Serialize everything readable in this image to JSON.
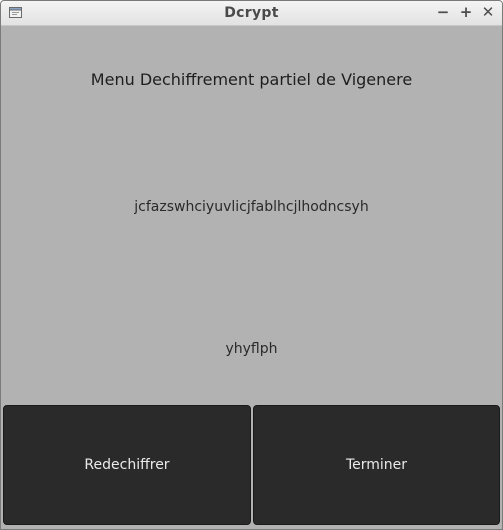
{
  "window": {
    "title": "Dcrypt",
    "controls": {
      "minimize": "−",
      "maximize": "+",
      "close": "✕"
    }
  },
  "main": {
    "heading": "Menu Dechiffrement partiel de Vigenere",
    "ciphertext": "jcfazswhciyuvlicjfablhcjlhodncsyh",
    "key": "yhyflph"
  },
  "buttons": {
    "redechiffrer": "Redechiffrer",
    "terminer": "Terminer"
  },
  "colors": {
    "background": "#b2b2b2",
    "button": "#2a2a2a",
    "button_text": "#ebebeb"
  }
}
